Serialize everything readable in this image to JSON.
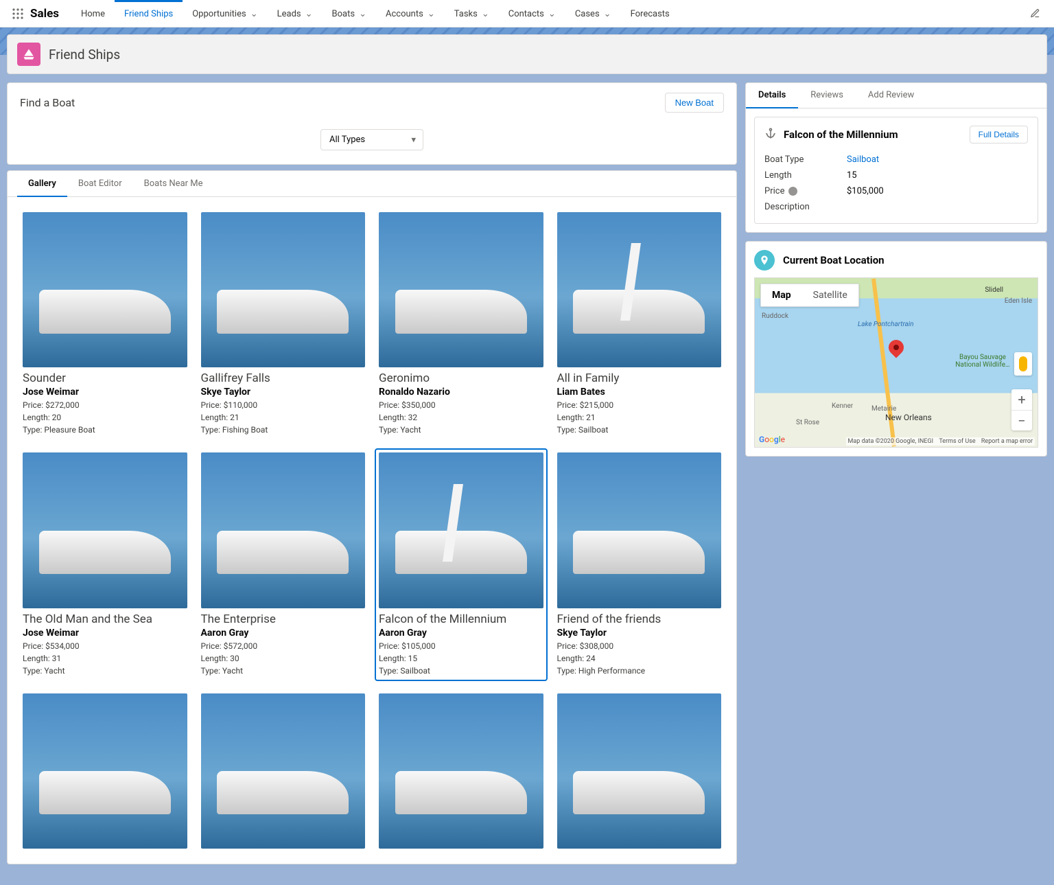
{
  "app": {
    "name": "Sales"
  },
  "nav": {
    "items": [
      {
        "label": "Home",
        "chev": false
      },
      {
        "label": "Friend Ships",
        "chev": false,
        "active": true
      },
      {
        "label": "Opportunities",
        "chev": true
      },
      {
        "label": "Leads",
        "chev": true
      },
      {
        "label": "Boats",
        "chev": true
      },
      {
        "label": "Accounts",
        "chev": true
      },
      {
        "label": "Tasks",
        "chev": true
      },
      {
        "label": "Contacts",
        "chev": true
      },
      {
        "label": "Cases",
        "chev": true
      },
      {
        "label": "Forecasts",
        "chev": false
      }
    ]
  },
  "page_header": {
    "title": "Friend Ships"
  },
  "search": {
    "title": "Find a Boat",
    "new_boat_label": "New Boat",
    "type_filter_value": "All Types"
  },
  "main_tabs": [
    {
      "label": "Gallery",
      "active": true
    },
    {
      "label": "Boat Editor"
    },
    {
      "label": "Boats Near Me"
    }
  ],
  "gallery": {
    "boats": [
      {
        "name": "Sounder",
        "owner": "Jose Weimar",
        "price": "$272,000",
        "length": "20",
        "type": "Pleasure Boat"
      },
      {
        "name": "Gallifrey Falls",
        "owner": "Skye Taylor",
        "price": "$110,000",
        "length": "21",
        "type": "Fishing Boat"
      },
      {
        "name": "Geronimo",
        "owner": "Ronaldo Nazario",
        "price": "$350,000",
        "length": "32",
        "type": "Yacht"
      },
      {
        "name": "All in Family",
        "owner": "Liam Bates",
        "price": "$215,000",
        "length": "21",
        "type": "Sailboat"
      },
      {
        "name": "The Old Man and the Sea",
        "owner": "Jose Weimar",
        "price": "$534,000",
        "length": "31",
        "type": "Yacht"
      },
      {
        "name": "The Enterprise",
        "owner": "Aaron Gray",
        "price": "$572,000",
        "length": "30",
        "type": "Yacht"
      },
      {
        "name": "Falcon of the Millennium",
        "owner": "Aaron Gray",
        "price": "$105,000",
        "length": "15",
        "type": "Sailboat",
        "selected": true
      },
      {
        "name": "Friend of the friends",
        "owner": "Skye Taylor",
        "price": "$308,000",
        "length": "24",
        "type": "High Performance"
      },
      {
        "name": "",
        "owner": "",
        "price": "",
        "length": "",
        "type": ""
      },
      {
        "name": "",
        "owner": "",
        "price": "",
        "length": "",
        "type": ""
      },
      {
        "name": "",
        "owner": "",
        "price": "",
        "length": "",
        "type": ""
      },
      {
        "name": "",
        "owner": "",
        "price": "",
        "length": "",
        "type": ""
      }
    ],
    "labels": {
      "price": "Price:",
      "length": "Length:",
      "type": "Type:"
    }
  },
  "details": {
    "tabs": [
      {
        "label": "Details",
        "active": true
      },
      {
        "label": "Reviews"
      },
      {
        "label": "Add Review"
      }
    ],
    "title": "Falcon of the Millennium",
    "full_details_label": "Full Details",
    "fields": {
      "boat_type": {
        "label": "Boat Type",
        "value": "Sailboat",
        "link": true
      },
      "length": {
        "label": "Length",
        "value": "15"
      },
      "price": {
        "label": "Price",
        "value": "$105,000",
        "info": true
      },
      "description": {
        "label": "Description",
        "value": ""
      }
    }
  },
  "map": {
    "title": "Current Boat Location",
    "map_btn": "Map",
    "sat_btn": "Satellite",
    "labels": {
      "slidell": "Slidell",
      "ruddock": "Ruddock",
      "lake": "Lake Pontchartrain",
      "eden": "Eden Isle",
      "kenner": "Kenner",
      "metairie": "Metairie",
      "nola": "New Orleans",
      "strose": "St Rose",
      "bayou": "Bayou Sauvage National Wildlife…"
    },
    "attrib": {
      "data": "Map data ©2020 Google, INEGI",
      "terms": "Terms of Use",
      "report": "Report a map error"
    }
  }
}
